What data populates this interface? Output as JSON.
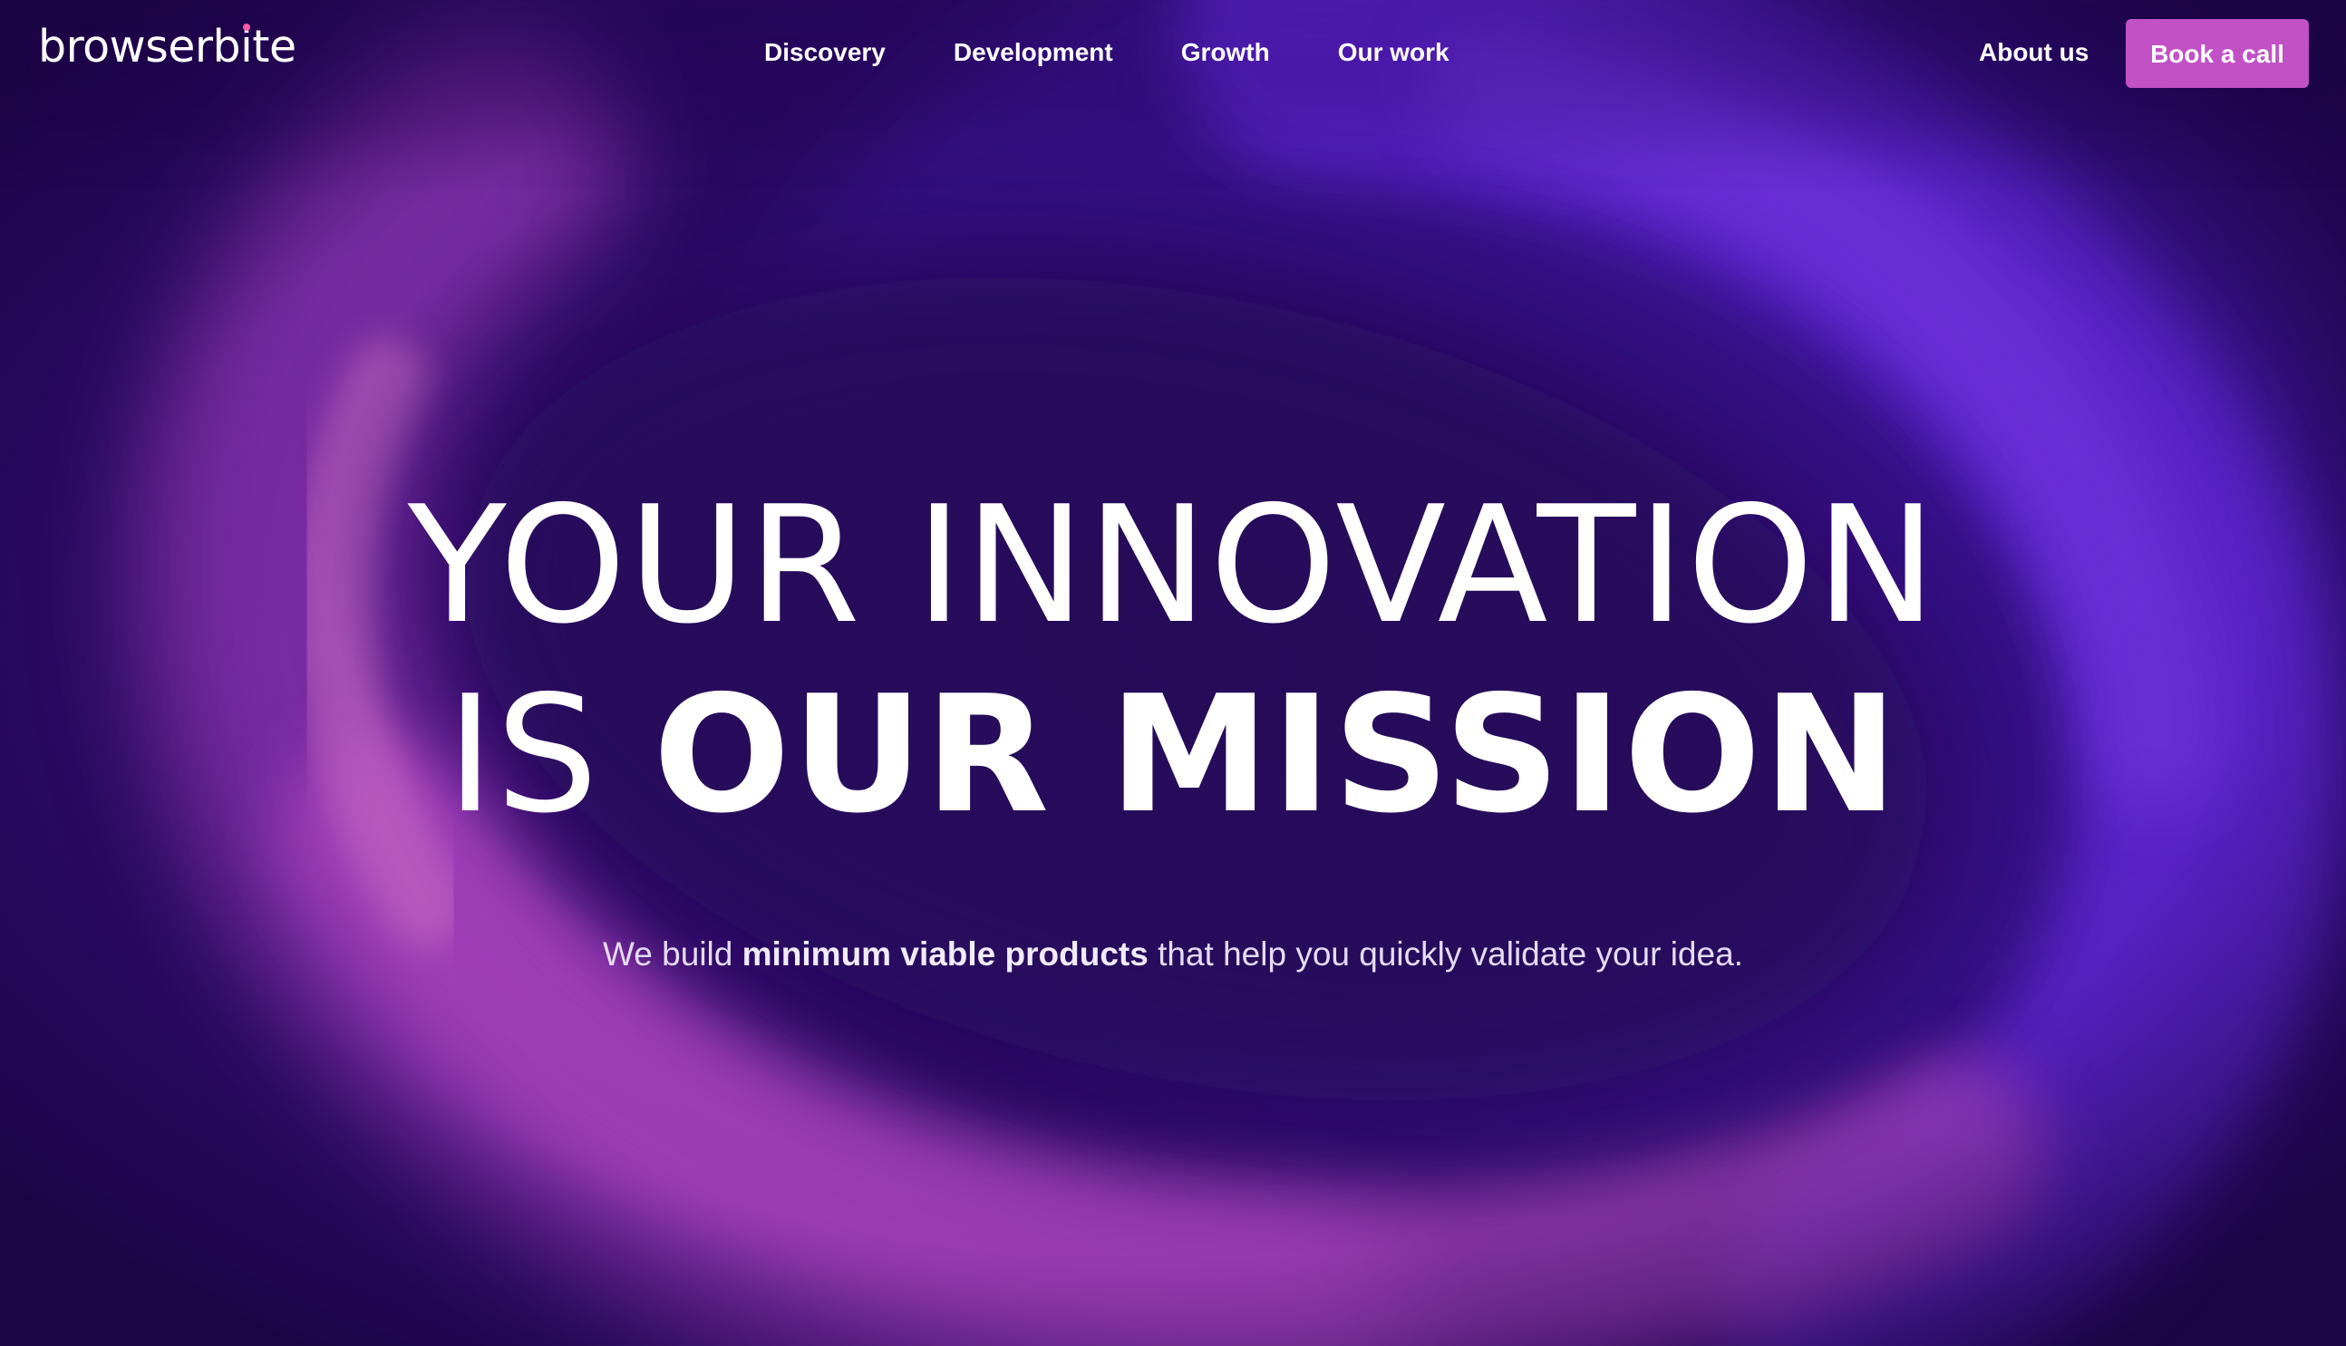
{
  "brand": {
    "logo_text_start": "browserb",
    "logo_text_i": "i",
    "logo_text_end": "te"
  },
  "nav": {
    "items": [
      {
        "label": "Discovery"
      },
      {
        "label": "Development"
      },
      {
        "label": "Growth"
      },
      {
        "label": "Our work"
      }
    ],
    "about_label": "About us",
    "cta_label": "Book a call"
  },
  "hero": {
    "line1": "YOUR INNOVATION",
    "line2_prefix": "IS ",
    "line2_emphasis": "OUR MISSION",
    "subtitle_before": "We build ",
    "subtitle_bold": "minimum viable products",
    "subtitle_after": " that help you quickly validate your idea."
  },
  "colors": {
    "background": "#270a5f",
    "ring_violet": "#6a2be8",
    "ring_magenta": "#c24fcf",
    "cta_background": "#c151c4",
    "text_primary": "#ffffff"
  }
}
